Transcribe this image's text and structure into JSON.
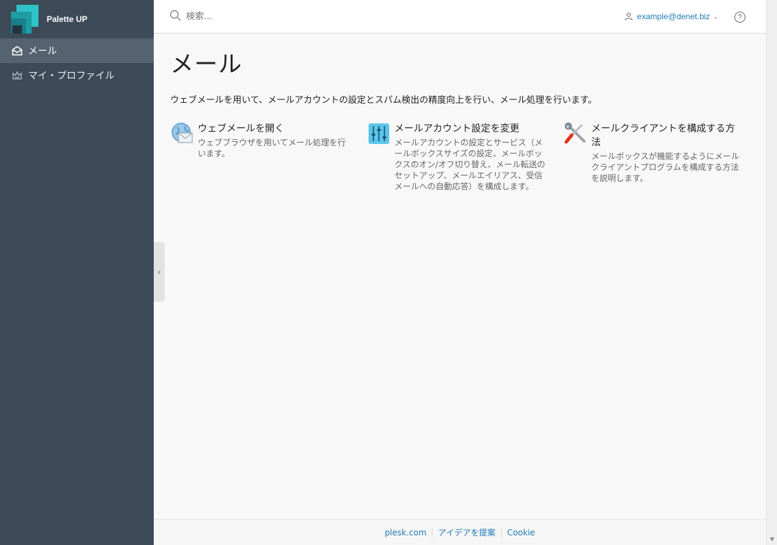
{
  "brand": {
    "name": "Palette UP"
  },
  "sidebar": {
    "items": [
      {
        "label": "メール",
        "icon": "envelope-open-icon",
        "active": true
      },
      {
        "label": "マイ・プロファイル",
        "icon": "crown-icon",
        "active": false
      }
    ]
  },
  "header": {
    "search_placeholder": "検索...",
    "user_email": "example@denet.biz",
    "help_label": "?"
  },
  "main": {
    "title": "メール",
    "description": "ウェブメールを用いて、メールアカウントの設定とスパム検出の精度向上を行い、メール処理を行います。",
    "cards": [
      {
        "title": "ウェブメールを開く",
        "description": "ウェブブラウザを用いてメール処理を行います。",
        "icon": "webmail-icon"
      },
      {
        "title": "メールアカウント設定を変更",
        "description": "メールアカウントの設定とサービス（メールボックスサイズの設定、メールボックスのオン/オフ切り替え、メール転送のセットアップ、メールエイリアス、受信メールへの自動応答）を構成します。",
        "icon": "sliders-icon"
      },
      {
        "title": "メールクライアントを構成する方法",
        "description": "メールボックスが機能するようにメールクライアントプログラムを構成する方法を説明します。",
        "icon": "tools-icon"
      }
    ]
  },
  "footer": {
    "links": [
      "plesk.com",
      "アイデアを提案",
      "Cookie"
    ]
  },
  "colors": {
    "sidebar_bg": "#3d4a57",
    "sidebar_active": "#55626f",
    "link": "#1f7cb4",
    "brand_teal": "#2ec4c7"
  }
}
